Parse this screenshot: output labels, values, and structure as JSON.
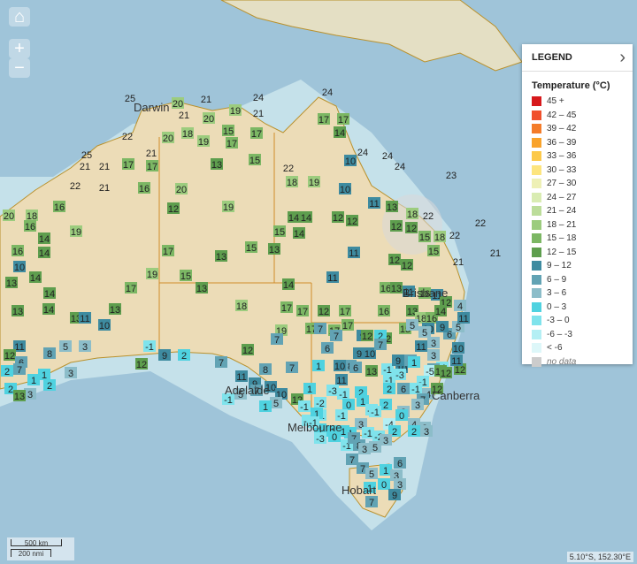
{
  "map": {
    "controls": {
      "home_icon": "home-icon",
      "zoom_in": "+",
      "zoom_out": "−"
    },
    "places": [
      "Darwin",
      "Brisbane",
      "Adelaide",
      "Canberra",
      "Melbourne",
      "Hobart"
    ],
    "legend": {
      "title": "LEGEND",
      "subtitle": "Temperature (°C)",
      "items": [
        {
          "label": "45 +",
          "color": "#d7191c"
        },
        {
          "label": "42 – 45",
          "color": "#f0502c"
        },
        {
          "label": "39 – 42",
          "color": "#f47c2a"
        },
        {
          "label": "36 – 39",
          "color": "#f9a32b"
        },
        {
          "label": "33 – 36",
          "color": "#fcc94a"
        },
        {
          "label": "30 – 33",
          "color": "#fde57e"
        },
        {
          "label": "27 – 30",
          "color": "#eef0b5"
        },
        {
          "label": "24 – 27",
          "color": "#d9ecb2"
        },
        {
          "label": "21 – 24",
          "color": "#bcdd9a"
        },
        {
          "label": "18 – 21",
          "color": "#9ccc7e"
        },
        {
          "label": "15 – 18",
          "color": "#7cb764"
        },
        {
          "label": "12 – 15",
          "color": "#5e9e4e"
        },
        {
          "label": "9 – 12",
          "color": "#3e8ba0"
        },
        {
          "label": "6 – 9",
          "color": "#62a3b4"
        },
        {
          "label": "3 – 6",
          "color": "#8cbdc9"
        },
        {
          "label": "0 – 3",
          "color": "#4fd2e0"
        },
        {
          "label": "-3 – 0",
          "color": "#7fe3ec"
        },
        {
          "label": "-6 – -3",
          "color": "#b4eff4"
        },
        {
          "label": "< -6",
          "color": "#ddf7f9"
        },
        {
          "label": "no data",
          "color": "#cccccc"
        }
      ]
    },
    "scale": {
      "km": "500 km",
      "nmi": "200 nmi"
    },
    "coords": "5.10°S, 152.30°E",
    "stations": [
      {
        "v": 25
      },
      {
        "v": 20
      },
      {
        "v": 21
      },
      {
        "v": 24
      },
      {
        "v": 24
      },
      {
        "v": 21
      },
      {
        "v": 20
      },
      {
        "v": 19
      },
      {
        "v": 21
      },
      {
        "v": 17
      },
      {
        "v": 17
      },
      {
        "v": 22
      },
      {
        "v": 20
      },
      {
        "v": 18
      },
      {
        "v": 19
      },
      {
        "v": 15
      },
      {
        "v": 14
      },
      {
        "v": 25
      },
      {
        "v": 21
      },
      {
        "v": 21
      },
      {
        "v": 21
      },
      {
        "v": 17
      },
      {
        "v": 17
      },
      {
        "v": 13
      },
      {
        "v": 15
      },
      {
        "v": 17
      },
      {
        "v": 10
      },
      {
        "v": 17
      },
      {
        "v": 24
      },
      {
        "v": 24
      },
      {
        "v": 24
      },
      {
        "v": 22
      },
      {
        "v": 21
      },
      {
        "v": 16
      },
      {
        "v": 20
      },
      {
        "v": 13
      },
      {
        "v": 22
      },
      {
        "v": 18
      },
      {
        "v": 19
      },
      {
        "v": 10
      },
      {
        "v": 23
      },
      {
        "v": 16
      },
      {
        "v": 11
      },
      {
        "v": 13
      },
      {
        "v": 20
      },
      {
        "v": 18
      },
      {
        "v": 16
      },
      {
        "v": 12
      },
      {
        "v": 19
      },
      {
        "v": 14
      },
      {
        "v": 14
      },
      {
        "v": 12
      },
      {
        "v": 12
      },
      {
        "v": 18
      },
      {
        "v": 12
      },
      {
        "v": 22
      },
      {
        "v": 22
      },
      {
        "v": 15
      },
      {
        "v": 19
      },
      {
        "v": 14
      },
      {
        "v": 14
      },
      {
        "v": 12
      },
      {
        "v": 15
      },
      {
        "v": 18
      },
      {
        "v": 13
      },
      {
        "v": 22
      },
      {
        "v": 16
      },
      {
        "v": 14
      },
      {
        "v": 11
      },
      {
        "v": 15
      },
      {
        "v": 17
      },
      {
        "v": 13
      },
      {
        "v": 12
      },
      {
        "v": 21
      },
      {
        "v": 19
      },
      {
        "v": 12
      },
      {
        "v": 15
      },
      {
        "v": 11
      },
      {
        "v": 10
      },
      {
        "v": 15
      },
      {
        "v": 21
      },
      {
        "v": 16
      },
      {
        "v": 13
      },
      {
        "v": 14
      },
      {
        "v": 13
      },
      {
        "v": 11
      },
      {
        "v": 14
      },
      {
        "v": 17
      },
      {
        "v": 16
      },
      {
        "v": 18
      },
      {
        "v": 14
      },
      {
        "v": 17
      },
      {
        "v": 12
      },
      {
        "v": 11
      },
      {
        "v": 13
      },
      {
        "v": 13
      },
      {
        "v": 13
      },
      {
        "v": 10
      },
      {
        "v": 14
      },
      {
        "v": 13
      },
      {
        "v": 13
      },
      {
        "v": 11
      },
      {
        "v": 12
      },
      {
        "v": 17
      },
      {
        "v": 19
      },
      {
        "v": 17
      },
      {
        "v": 17
      },
      {
        "v": 17
      },
      {
        "v": 17
      },
      {
        "v": 7
      },
      {
        "v": 7
      },
      {
        "v": 9
      },
      {
        "v": 12
      },
      {
        "v": 16
      },
      {
        "v": 12
      },
      {
        "v": 18
      },
      {
        "v": 16
      },
      {
        "v": 14
      },
      {
        "v": 10
      },
      {
        "v": 15
      },
      {
        "v": 4
      },
      {
        "v": 3
      },
      {
        "v": 6
      },
      {
        "v": 5
      },
      {
        "v": 11
      },
      {
        "v": 9
      },
      {
        "v": 11
      },
      {
        "v": 12
      },
      {
        "v": 10
      },
      {
        "v": 2
      },
      {
        "v": 5
      },
      {
        "v": 5
      },
      {
        "v": 6
      },
      {
        "v": 8
      },
      {
        "v": 5
      },
      {
        "v": 3
      },
      {
        "v": -1
      },
      {
        "v": 2
      },
      {
        "v": 7
      },
      {
        "v": 12
      },
      {
        "v": 7
      },
      {
        "v": 9
      },
      {
        "v": 12
      },
      {
        "v": 11
      },
      {
        "v": 3
      },
      {
        "v": -1
      },
      {
        "v": 1
      },
      {
        "v": 6
      },
      {
        "v": 8
      },
      {
        "v": 10
      },
      {
        "v": 8
      },
      {
        "v": 6
      },
      {
        "v": 12
      },
      {
        "v": 11
      },
      {
        "v": 7
      },
      {
        "v": 2
      },
      {
        "v": 1
      },
      {
        "v": 3
      },
      {
        "v": 2
      },
      {
        "v": 1
      },
      {
        "v": 2
      },
      {
        "v": 3
      },
      {
        "v": 13
      },
      {
        "v": 8
      },
      {
        "v": 7
      },
      {
        "v": 11
      },
      {
        "v": 9
      },
      {
        "v": 10
      },
      {
        "v": 10
      },
      {
        "v": 12
      },
      {
        "v": 11
      },
      {
        "v": 10
      },
      {
        "v": 13
      },
      {
        "v": 6
      },
      {
        "v": -1
      },
      {
        "v": 1
      },
      {
        "v": -5
      },
      {
        "v": -1
      },
      {
        "v": -3
      },
      {
        "v": -1
      },
      {
        "v": -1
      },
      {
        "v": 4
      },
      {
        "v": 13
      },
      {
        "v": 12
      },
      {
        "v": 9
      },
      {
        "v": 9
      },
      {
        "v": 10
      },
      {
        "v": 7
      },
      {
        "v": 7
      },
      {
        "v": 5
      },
      {
        "v": -1
      },
      {
        "v": 1
      },
      {
        "v": -2
      },
      {
        "v": -3
      },
      {
        "v": -1
      },
      {
        "v": 2
      },
      {
        "v": 2
      },
      {
        "v": 6
      },
      {
        "v": 7
      },
      {
        "v": 12
      },
      {
        "v": 5
      },
      {
        "v": 1
      },
      {
        "v": -1
      },
      {
        "v": -1
      },
      {
        "v": 0
      },
      {
        "v": 1
      },
      {
        "v": -2
      },
      {
        "v": 2
      },
      {
        "v": 3
      },
      {
        "v": 3
      },
      {
        "v": -2
      },
      {
        "v": 1
      },
      {
        "v": -1
      },
      {
        "v": -1
      },
      {
        "v": -4
      },
      {
        "v": 0
      },
      {
        "v": 4
      },
      {
        "v": 3
      },
      {
        "v": 3
      },
      {
        "v": 1
      },
      {
        "v": 1
      },
      {
        "v": 1
      },
      {
        "v": -1
      },
      {
        "v": -1
      },
      {
        "v": -2
      },
      {
        "v": 2
      },
      {
        "v": 2
      },
      {
        "v": 3
      },
      {
        "v": -1
      },
      {
        "v": -3
      },
      {
        "v": 0
      },
      {
        "v": 1
      },
      {
        "v": 7
      },
      {
        "v": 8
      },
      {
        "v": 3
      },
      {
        "v": 5
      },
      {
        "v": 3
      },
      {
        "v": 7
      },
      {
        "v": 7
      },
      {
        "v": 5
      },
      {
        "v": 1
      },
      {
        "v": 6
      },
      {
        "v": 3
      },
      {
        "v": 1
      },
      {
        "v": 0
      },
      {
        "v": 3
      },
      {
        "v": 9
      },
      {
        "v": 7
      }
    ]
  }
}
